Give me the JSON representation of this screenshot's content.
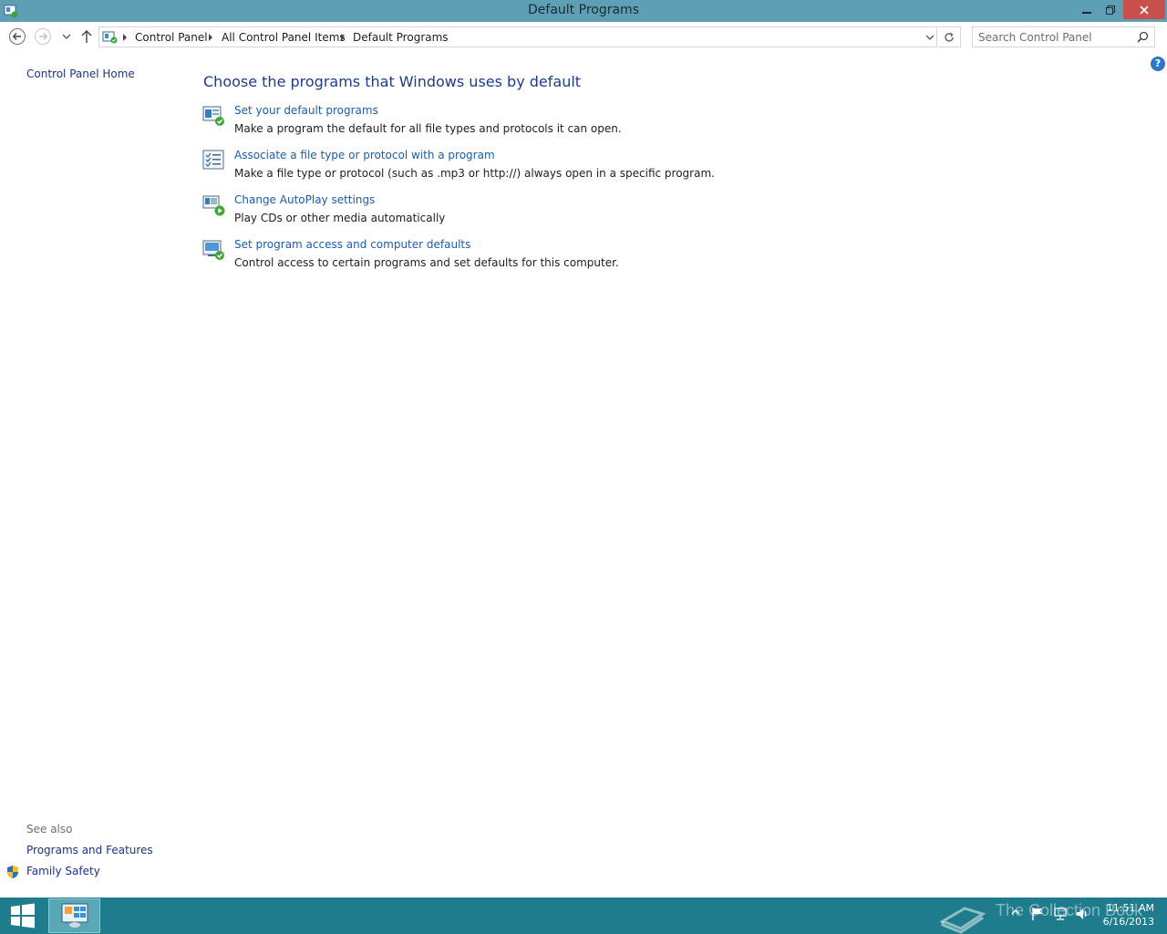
{
  "window": {
    "title": "Default Programs"
  },
  "navigation": {
    "breadcrumbs": [
      "Control Panel",
      "All Control Panel Items",
      "Default Programs"
    ],
    "search_placeholder": "Search Control Panel"
  },
  "left_pane": {
    "home_link": "Control Panel Home",
    "see_also_label": "See also",
    "see_also_links": [
      "Programs and Features",
      "Family Safety"
    ]
  },
  "main": {
    "heading": "Choose the programs that Windows uses by default",
    "tasks": [
      {
        "icon": "default-programs-icon",
        "link": "Set your default programs",
        "description": "Make a program the default for all file types and protocols it can open."
      },
      {
        "icon": "file-association-icon",
        "link": "Associate a file type or protocol with a program",
        "description": "Make a file type or protocol (such as .mp3 or http://) always open in a specific program."
      },
      {
        "icon": "autoplay-icon",
        "link": "Change AutoPlay settings",
        "description": "Play CDs or other media automatically"
      },
      {
        "icon": "program-access-icon",
        "link": "Set program access and computer defaults",
        "description": "Control access to certain programs and set defaults for this computer."
      }
    ]
  },
  "taskbar": {
    "watermark": "The Collection Book",
    "time": "11:51 AM",
    "date": "6/16/2013"
  },
  "colors": {
    "titlebar": "#5f9fb5",
    "close_button": "#c7504d",
    "taskbar": "#1e7c8c",
    "link": "#1b5cac"
  }
}
